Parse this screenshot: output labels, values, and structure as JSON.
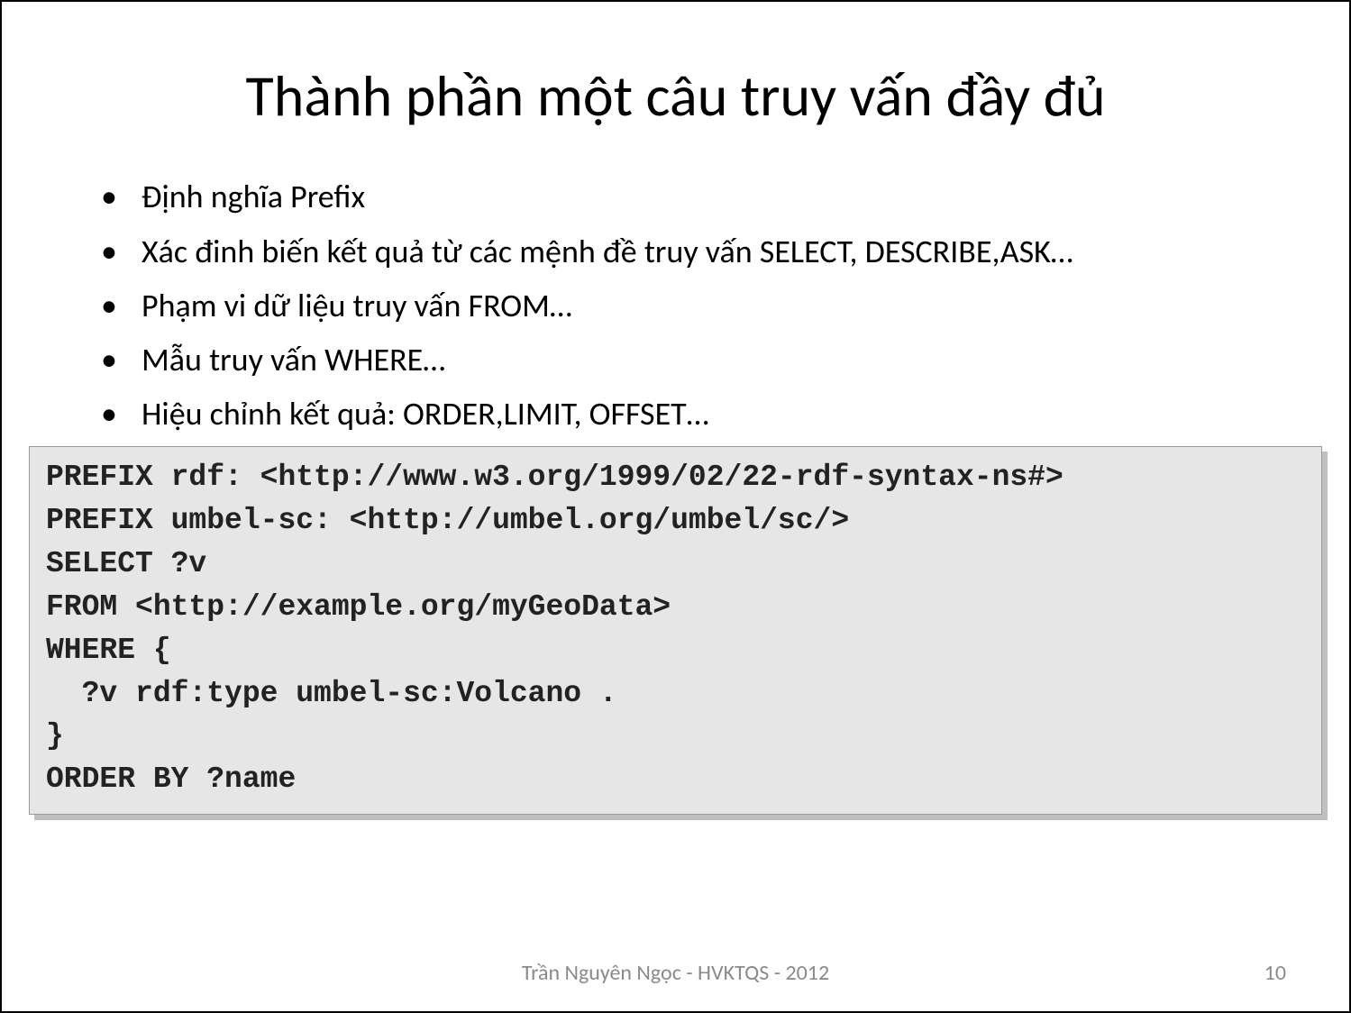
{
  "title": "Thành phần một câu truy vấn đầy đủ",
  "bullets": [
    "Định nghĩa Prefix",
    "Xác đinh biến kết quả từ các mệnh đề truy vấn SELECT, DESCRIBE,ASK…",
    "Phạm vi dữ liệu truy vấn FROM…",
    "Mẫu truy vấn WHERE…",
    "Hiệu chỉnh kết quả: ORDER,LIMIT, OFFSET…"
  ],
  "code": "PREFIX rdf: <http://www.w3.org/1999/02/22-rdf-syntax-ns#>\nPREFIX umbel-sc: <http://umbel.org/umbel/sc/>\nSELECT ?v\nFROM <http://example.org/myGeoData>\nWHERE {\n  ?v rdf:type umbel-sc:Volcano .\n}\nORDER BY ?name",
  "footer": "Trần Nguyên Ngọc - HVKTQS - 2012",
  "page": "10"
}
